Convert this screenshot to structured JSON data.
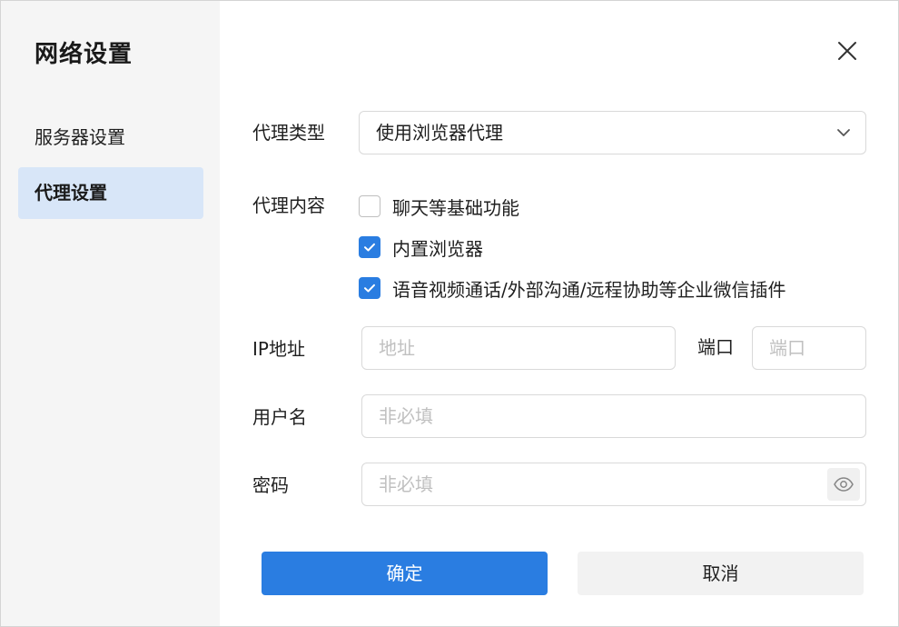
{
  "sidebar": {
    "title": "网络设置",
    "items": [
      {
        "label": "服务器设置",
        "active": false
      },
      {
        "label": "代理设置",
        "active": true
      }
    ]
  },
  "form": {
    "proxy_type": {
      "label": "代理类型",
      "value": "使用浏览器代理"
    },
    "proxy_content": {
      "label": "代理内容",
      "options": [
        {
          "label": "聊天等基础功能",
          "checked": false
        },
        {
          "label": "内置浏览器",
          "checked": true
        },
        {
          "label": "语音视频通话/外部沟通/远程协助等企业微信插件",
          "checked": true
        }
      ]
    },
    "ip": {
      "label": "IP地址",
      "placeholder": "地址"
    },
    "port": {
      "label": "端口",
      "placeholder": "端口"
    },
    "username": {
      "label": "用户名",
      "placeholder": "非必填"
    },
    "password": {
      "label": "密码",
      "placeholder": "非必填"
    }
  },
  "buttons": {
    "confirm": "确定",
    "cancel": "取消"
  },
  "icons": {
    "close": "close-icon",
    "dropdown": "chevron-down-icon",
    "check": "check-icon",
    "eye": "eye-icon"
  },
  "colors": {
    "accent": "#2a7de1",
    "sidebar_bg": "#f5f5f5",
    "active_item_bg": "#d8e6f8"
  }
}
